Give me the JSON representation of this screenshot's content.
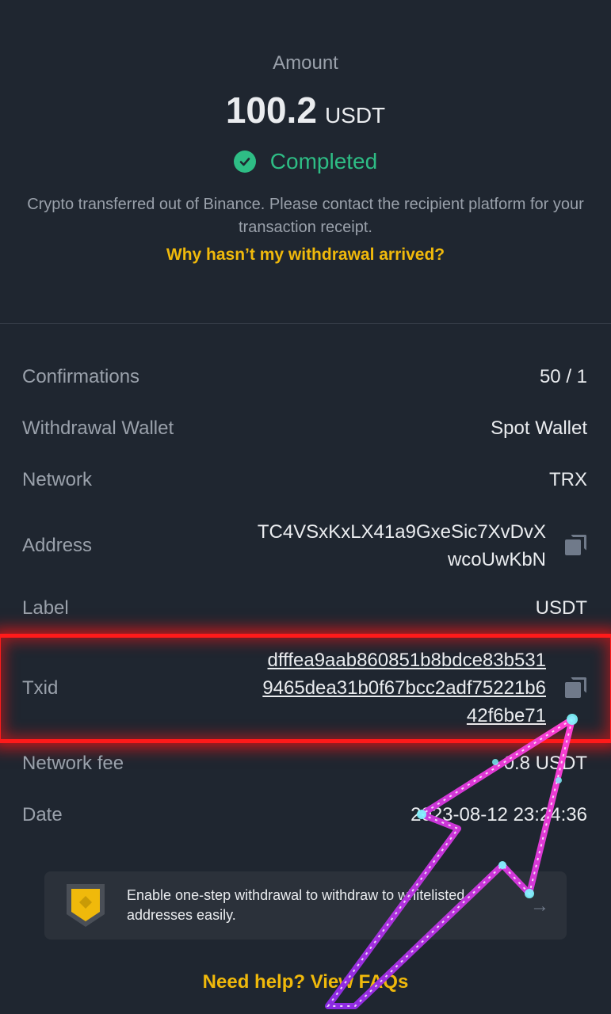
{
  "summary": {
    "amount_label": "Amount",
    "amount_value": "100.2",
    "amount_unit": "USDT",
    "status_text": "Completed",
    "description": "Crypto transferred out of Binance. Please contact the recipient platform for your transaction receipt.",
    "why_link": "Why hasn’t my withdrawal arrived?"
  },
  "details": {
    "confirmations": {
      "label": "Confirmations",
      "value": "50 / 1"
    },
    "wallet": {
      "label": "Withdrawal Wallet",
      "value": "Spot Wallet"
    },
    "network": {
      "label": "Network",
      "value": "TRX"
    },
    "address": {
      "label": "Address",
      "line1": "TC4VSxKxLX41a9GxeSic7XvDvX",
      "line2": "wcoUwKbN"
    },
    "label_row": {
      "label": "Label",
      "value": "USDT"
    },
    "txid": {
      "label": "Txid",
      "line1": "dfffea9aab860851b8bdce83b531",
      "line2": "9465dea31b0f67bcc2adf75221b6",
      "line3": "42f6be71"
    },
    "fee": {
      "label": "Network fee",
      "value": "0.8 USDT"
    },
    "date": {
      "label": "Date",
      "value": "2023-08-12 23:24:36"
    }
  },
  "banner": {
    "text": "Enable one-step withdrawal to withdraw to whitelisted addresses easily.",
    "icon": "shield-icon"
  },
  "help_link": "Need help? View FAQs",
  "colors": {
    "background": "#1f2630",
    "success": "#2ebd85",
    "accent": "#f0b90b",
    "highlight": "#ff1a1a"
  }
}
